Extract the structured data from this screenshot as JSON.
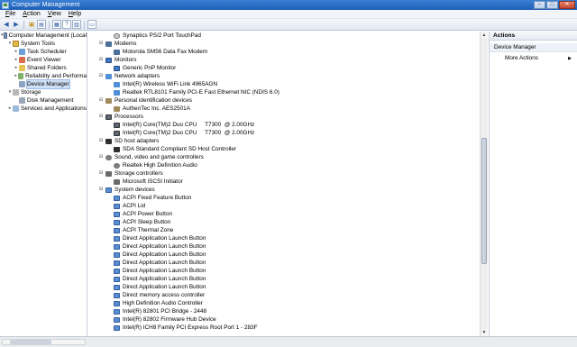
{
  "window": {
    "title": "Computer Management"
  },
  "menu": [
    {
      "key": "F",
      "rest": "ile"
    },
    {
      "key": "A",
      "rest": "ction"
    },
    {
      "key": "V",
      "rest": "iew"
    },
    {
      "key": "H",
      "rest": "elp"
    }
  ],
  "tree": [
    {
      "label": "Computer Management (Local",
      "level": 0,
      "exp": "▾",
      "icon": "computer-management-icon",
      "cls": "cm"
    },
    {
      "label": "System Tools",
      "level": 1,
      "exp": "▾",
      "icon": "toolbox-icon",
      "cls": "tools"
    },
    {
      "label": "Task Scheduler",
      "level": 2,
      "exp": "▸",
      "icon": "clock-icon",
      "cls": "task"
    },
    {
      "label": "Event Viewer",
      "level": 2,
      "exp": "▸",
      "icon": "event-viewer-icon",
      "cls": "event"
    },
    {
      "label": "Shared Folders",
      "level": 2,
      "exp": "▸",
      "icon": "shared-folder-icon",
      "cls": "share"
    },
    {
      "label": "Reliability and Performa",
      "level": 2,
      "exp": "▸",
      "icon": "performance-icon",
      "cls": "rel"
    },
    {
      "label": "Device Manager",
      "level": 2,
      "exp": "",
      "icon": "device-manager-icon",
      "cls": "dev",
      "selected": true
    },
    {
      "label": "Storage",
      "level": 1,
      "exp": "▾",
      "icon": "storage-icon",
      "cls": "store"
    },
    {
      "label": "Disk Management",
      "level": 2,
      "exp": "",
      "icon": "disk-icon",
      "cls": "disk"
    },
    {
      "label": "Services and Applications",
      "level": 1,
      "exp": "▸",
      "icon": "services-icon",
      "cls": "svc"
    }
  ],
  "devices": [
    {
      "label": "Synaptics PS/2 Port TouchPad",
      "type": "child",
      "icon": "mouse-icon",
      "cls": "i-mouse"
    },
    {
      "label": "Modems",
      "type": "cat",
      "icon": "modem-icon",
      "cls": "i-modem"
    },
    {
      "label": "Motorola SM56 Data Fax Modem",
      "type": "child",
      "icon": "modem-icon",
      "cls": "i-modem"
    },
    {
      "label": "Monitors",
      "type": "cat",
      "icon": "monitor-icon",
      "cls": "i-monitor"
    },
    {
      "label": "Generic PnP Monitor",
      "type": "child",
      "icon": "monitor-icon",
      "cls": "i-monitor"
    },
    {
      "label": "Network adapters",
      "type": "cat",
      "icon": "network-adapter-icon",
      "cls": "i-net"
    },
    {
      "label": "Intel(R) Wireless WiFi Link 4965AGN",
      "type": "child",
      "icon": "network-adapter-icon",
      "cls": "i-net"
    },
    {
      "label": "Realtek RTL8101 Family PCI-E Fast Ethernet NIC (NDIS 6.0)",
      "type": "child",
      "icon": "network-adapter-icon",
      "cls": "i-net"
    },
    {
      "label": "Personal identification devices",
      "type": "cat",
      "icon": "fingerprint-icon",
      "cls": "i-person"
    },
    {
      "label": "AuthenTec Inc. AES2501A",
      "type": "child",
      "icon": "fingerprint-icon",
      "cls": "i-person"
    },
    {
      "label": "Processors",
      "type": "cat",
      "icon": "processor-icon",
      "cls": "i-cpu"
    },
    {
      "label": "Intel(R) Core(TM)2 Duo CPU     T7300  @ 2.00GHz",
      "type": "child",
      "icon": "processor-icon",
      "cls": "i-cpu"
    },
    {
      "label": "Intel(R) Core(TM)2 Duo CPU     T7300  @ 2.00GHz",
      "type": "child",
      "icon": "processor-icon",
      "cls": "i-cpu"
    },
    {
      "label": "SD host adapters",
      "type": "cat",
      "icon": "sd-card-icon",
      "cls": "i-sd"
    },
    {
      "label": "SDA Standard Compliant SD Host Controller",
      "type": "child",
      "icon": "sd-card-icon",
      "cls": "i-sd"
    },
    {
      "label": "Sound, video and game controllers",
      "type": "cat",
      "icon": "speaker-icon",
      "cls": "i-sound"
    },
    {
      "label": "Realtek High Definition Audio",
      "type": "child",
      "icon": "speaker-icon",
      "cls": "i-sound"
    },
    {
      "label": "Storage controllers",
      "type": "cat",
      "icon": "storage-controller-icon",
      "cls": "i-store"
    },
    {
      "label": "Microsoft iSCSI Initiator",
      "type": "child",
      "icon": "storage-controller-icon",
      "cls": "i-store"
    },
    {
      "label": "System devices",
      "type": "cat",
      "icon": "system-device-icon",
      "cls": "i-sys"
    },
    {
      "label": "ACPI Fixed Feature Button",
      "type": "child",
      "icon": "system-device-icon",
      "cls": "i-sys"
    },
    {
      "label": "ACPI Lid",
      "type": "child",
      "icon": "system-device-icon",
      "cls": "i-sys"
    },
    {
      "label": "ACPI Power Button",
      "type": "child",
      "icon": "system-device-icon",
      "cls": "i-sys"
    },
    {
      "label": "ACPI Sleep Button",
      "type": "child",
      "icon": "system-device-icon",
      "cls": "i-sys"
    },
    {
      "label": "ACPI Thermal Zone",
      "type": "child",
      "icon": "system-device-icon",
      "cls": "i-sys"
    },
    {
      "label": "Direct Application Launch Button",
      "type": "child",
      "icon": "system-device-icon",
      "cls": "i-sys"
    },
    {
      "label": "Direct Application Launch Button",
      "type": "child",
      "icon": "system-device-icon",
      "cls": "i-sys"
    },
    {
      "label": "Direct Application Launch Button",
      "type": "child",
      "icon": "system-device-icon",
      "cls": "i-sys"
    },
    {
      "label": "Direct Application Launch Button",
      "type": "child",
      "icon": "system-device-icon",
      "cls": "i-sys"
    },
    {
      "label": "Direct Application Launch Button",
      "type": "child",
      "icon": "system-device-icon",
      "cls": "i-sys"
    },
    {
      "label": "Direct Application Launch Button",
      "type": "child",
      "icon": "system-device-icon",
      "cls": "i-sys"
    },
    {
      "label": "Direct Application Launch Button",
      "type": "child",
      "icon": "system-device-icon",
      "cls": "i-sys"
    },
    {
      "label": "Direct memory access controller",
      "type": "child",
      "icon": "system-device-icon",
      "cls": "i-sys"
    },
    {
      "label": "High Definition Audio Controller",
      "type": "child",
      "icon": "system-device-icon",
      "cls": "i-sys"
    },
    {
      "label": "Intel(R) 82801 PCI Bridge - 2448",
      "type": "child",
      "icon": "system-device-icon",
      "cls": "i-sys"
    },
    {
      "label": "Intel(R) 82802 Firmware Hub Device",
      "type": "child",
      "icon": "system-device-icon",
      "cls": "i-sys"
    },
    {
      "label": "Intel(R) ICH8 Family PCI Express Root Port 1 - 283F",
      "type": "child",
      "icon": "system-device-icon",
      "cls": "i-sys"
    }
  ],
  "actions": {
    "header": "Actions",
    "section": "Device Manager",
    "items": [
      {
        "label": "More Actions"
      }
    ]
  }
}
